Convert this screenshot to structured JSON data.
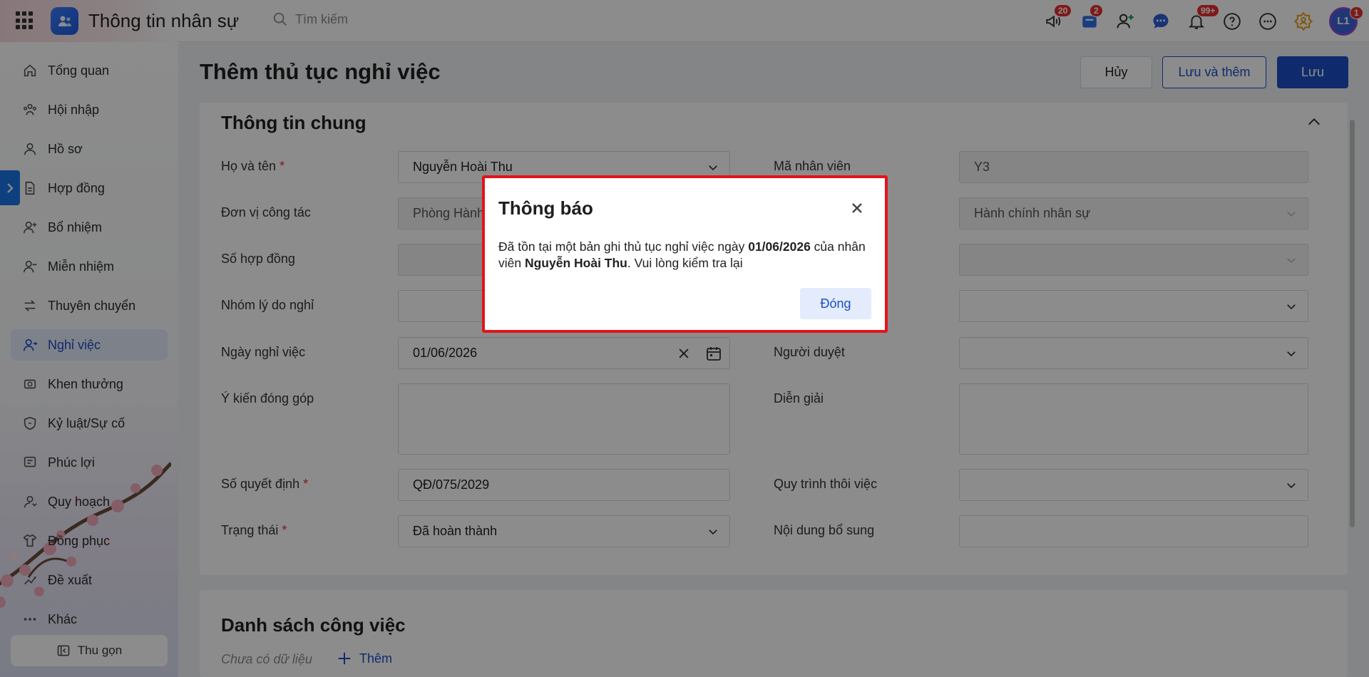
{
  "app": {
    "title": "Thông tin nhân sự",
    "search_placeholder": "Tìm kiếm"
  },
  "topbar": {
    "badges": {
      "announce": "20",
      "cart": "2",
      "notifications": "99+",
      "avatar": "1"
    },
    "avatar_initials": "L1"
  },
  "sidebar": {
    "items": [
      {
        "label": "Tổng quan",
        "icon": "home-icon"
      },
      {
        "label": "Hội nhập",
        "icon": "team-icon"
      },
      {
        "label": "Hồ sơ",
        "icon": "user-icon"
      },
      {
        "label": "Hợp đồng",
        "icon": "document-icon"
      },
      {
        "label": "Bổ nhiệm",
        "icon": "user-plus-icon"
      },
      {
        "label": "Miễn nhiệm",
        "icon": "user-minus-icon"
      },
      {
        "label": "Thuyên chuyển",
        "icon": "transfer-icon"
      },
      {
        "label": "Nghỉ việc",
        "icon": "user-leave-icon"
      },
      {
        "label": "Khen thưởng",
        "icon": "award-icon"
      },
      {
        "label": "Kỷ luật/Sự cố",
        "icon": "shield-icon"
      },
      {
        "label": "Phúc lợi",
        "icon": "benefit-icon"
      },
      {
        "label": "Quy hoạch",
        "icon": "plan-icon"
      },
      {
        "label": "Đồng phục",
        "icon": "shirt-icon"
      },
      {
        "label": "Đề xuất",
        "icon": "proposal-icon"
      },
      {
        "label": "Khác",
        "icon": "more-icon"
      }
    ],
    "collapse_label": "Thu gọn",
    "active_index": 7
  },
  "page": {
    "title": "Thêm thủ tục nghỉ việc",
    "buttons": {
      "cancel": "Hủy",
      "save_add": "Lưu và thêm",
      "save": "Lưu"
    }
  },
  "general": {
    "title": "Thông tin chung",
    "labels": {
      "full_name": "Họ và tên",
      "employee_code": "Mã nhân viên",
      "unit": "Đơn vị công tác",
      "contract_no": "Số hợp đồng",
      "reason_group": "Nhóm lý do nghỉ",
      "leave_date": "Ngày nghỉ việc",
      "approver": "Người duyệt",
      "feedback": "Ý kiến đóng góp",
      "explanation": "Diễn giải",
      "decision_no": "Số quyết định",
      "process": "Quy trình thôi việc",
      "status": "Trạng thái",
      "extra": "Nội dung bổ sung"
    },
    "required_mark": "*",
    "values": {
      "full_name": "Nguyễn Hoài Thu",
      "employee_code": "Y3",
      "unit": "Phòng Hành",
      "position": "Hành chính nhân sự",
      "leave_date": "01/06/2026",
      "decision_no": "QĐ/075/2029",
      "status": "Đã hoàn thành"
    }
  },
  "tasks": {
    "title": "Danh sách công việc",
    "empty": "Chưa có dữ liệu",
    "add": "Thêm"
  },
  "dialog": {
    "title": "Thông báo",
    "msg_1": "Đã tồn tại một bản ghi thủ tục nghỉ việc ngày ",
    "msg_date": "01/06/2026",
    "msg_2": " của nhân viên ",
    "msg_name": "Nguyễn Hoài Thu",
    "msg_3": ". Vui lòng kiểm tra lại",
    "ok": "Đóng"
  }
}
